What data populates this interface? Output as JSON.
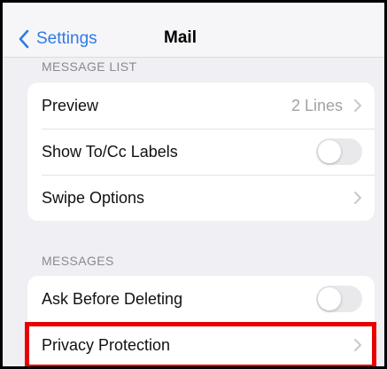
{
  "navbar": {
    "back_label": "Settings",
    "title": "Mail"
  },
  "sections": {
    "message_list": {
      "header": "MESSAGE LIST",
      "preview_label": "Preview",
      "preview_value": "2 Lines",
      "show_to_cc_label": "Show To/Cc Labels",
      "show_to_cc_on": false,
      "swipe_options_label": "Swipe Options"
    },
    "messages": {
      "header": "MESSAGES",
      "ask_before_deleting_label": "Ask Before Deleting",
      "ask_before_deleting_on": false,
      "privacy_protection_label": "Privacy Protection"
    }
  },
  "colors": {
    "accent": "#2f7ae5",
    "highlight": "#e80000",
    "background": "#efeff4"
  }
}
